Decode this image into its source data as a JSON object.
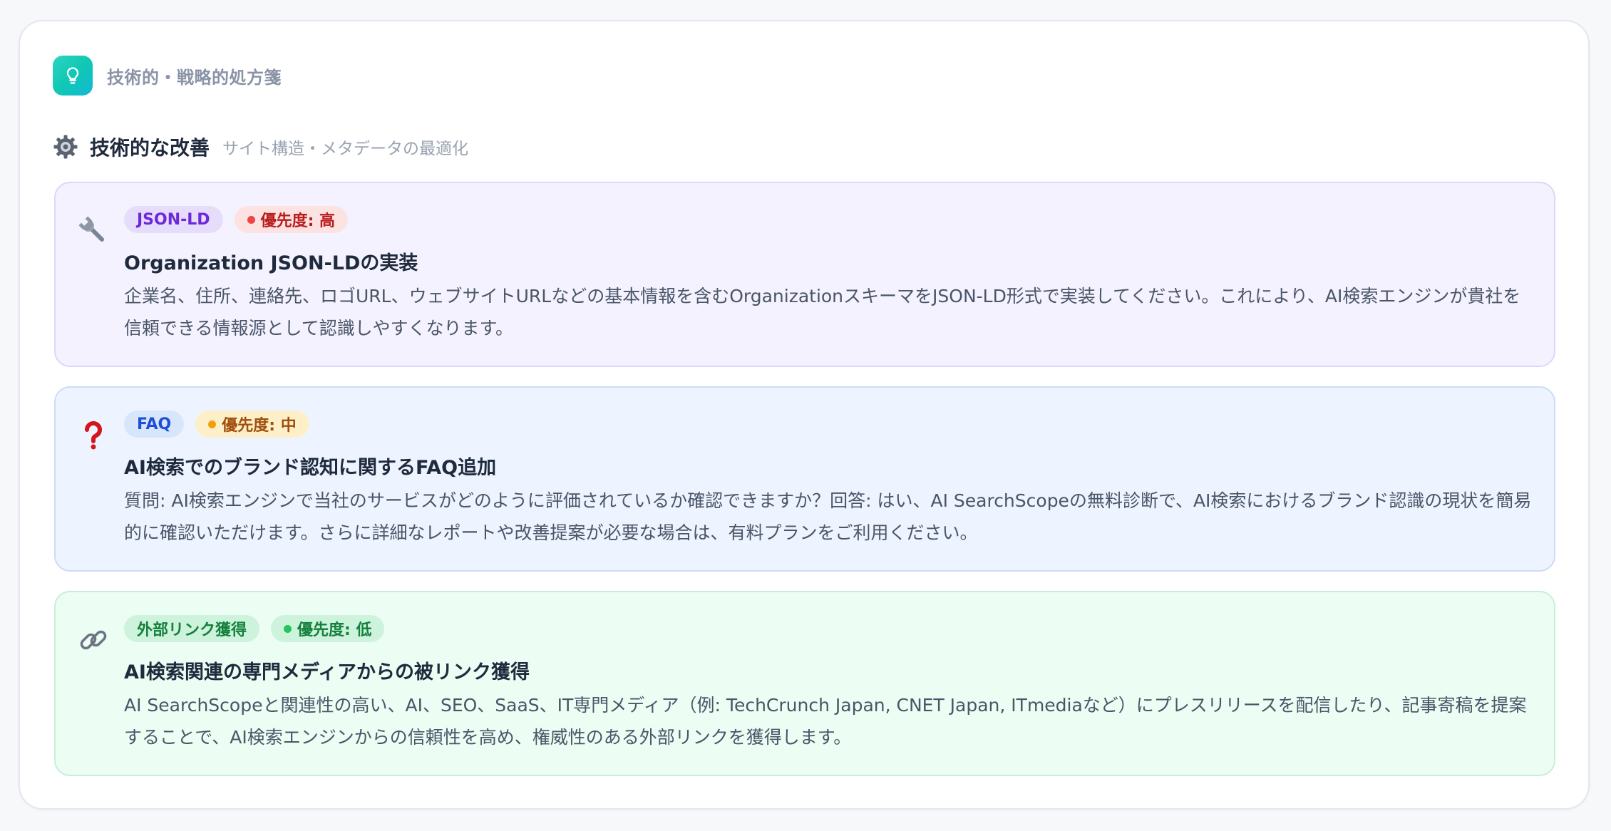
{
  "header": {
    "icon": "lightbulb-icon",
    "label": "技術的・戦略的処方箋",
    "accent": "#14c8b8"
  },
  "section": {
    "icon": "gear-icon",
    "title": "技術的な改善",
    "subtitle": "サイト構造・メタデータの最適化"
  },
  "cards": [
    {
      "icon": "wrench-icon",
      "category": "JSON-LD",
      "priority": "優先度: 高",
      "priority_color": "#ef4444",
      "title": "Organization JSON-LDの実装",
      "body": "企業名、住所、連絡先、ロゴURL、ウェブサイトURLなどの基本情報を含むOrganizationスキーマをJSON-LD形式で実装してください。これにより、AI検索エンジンが貴社を信頼できる情報源として認識しやすくなります。"
    },
    {
      "icon": "question-mark-icon",
      "category": "FAQ",
      "priority": "優先度: 中",
      "priority_color": "#f59e0b",
      "title": "AI検索でのブランド認知に関するFAQ追加",
      "body": "質問: AI検索エンジンで当社のサービスがどのように評価されているか確認できますか？回答: はい、AI SearchScopeの無料診断で、AI検索におけるブランド認識の現状を簡易的に確認いただけます。さらに詳細なレポートや改善提案が必要な場合は、有料プランをご利用ください。"
    },
    {
      "icon": "link-icon",
      "category": "外部リンク獲得",
      "priority": "優先度: 低",
      "priority_color": "#22c55e",
      "title": "AI検索関連の専門メディアからの被リンク獲得",
      "body": "AI SearchScopeと関連性の高い、AI、SEO、SaaS、IT専門メディア（例: TechCrunch Japan, CNET Japan, ITmediaなど）にプレスリリースを配信したり、記事寄稿を提案することで、AI検索エンジンからの信頼性を高め、権威性のある外部リンクを獲得します。"
    }
  ]
}
